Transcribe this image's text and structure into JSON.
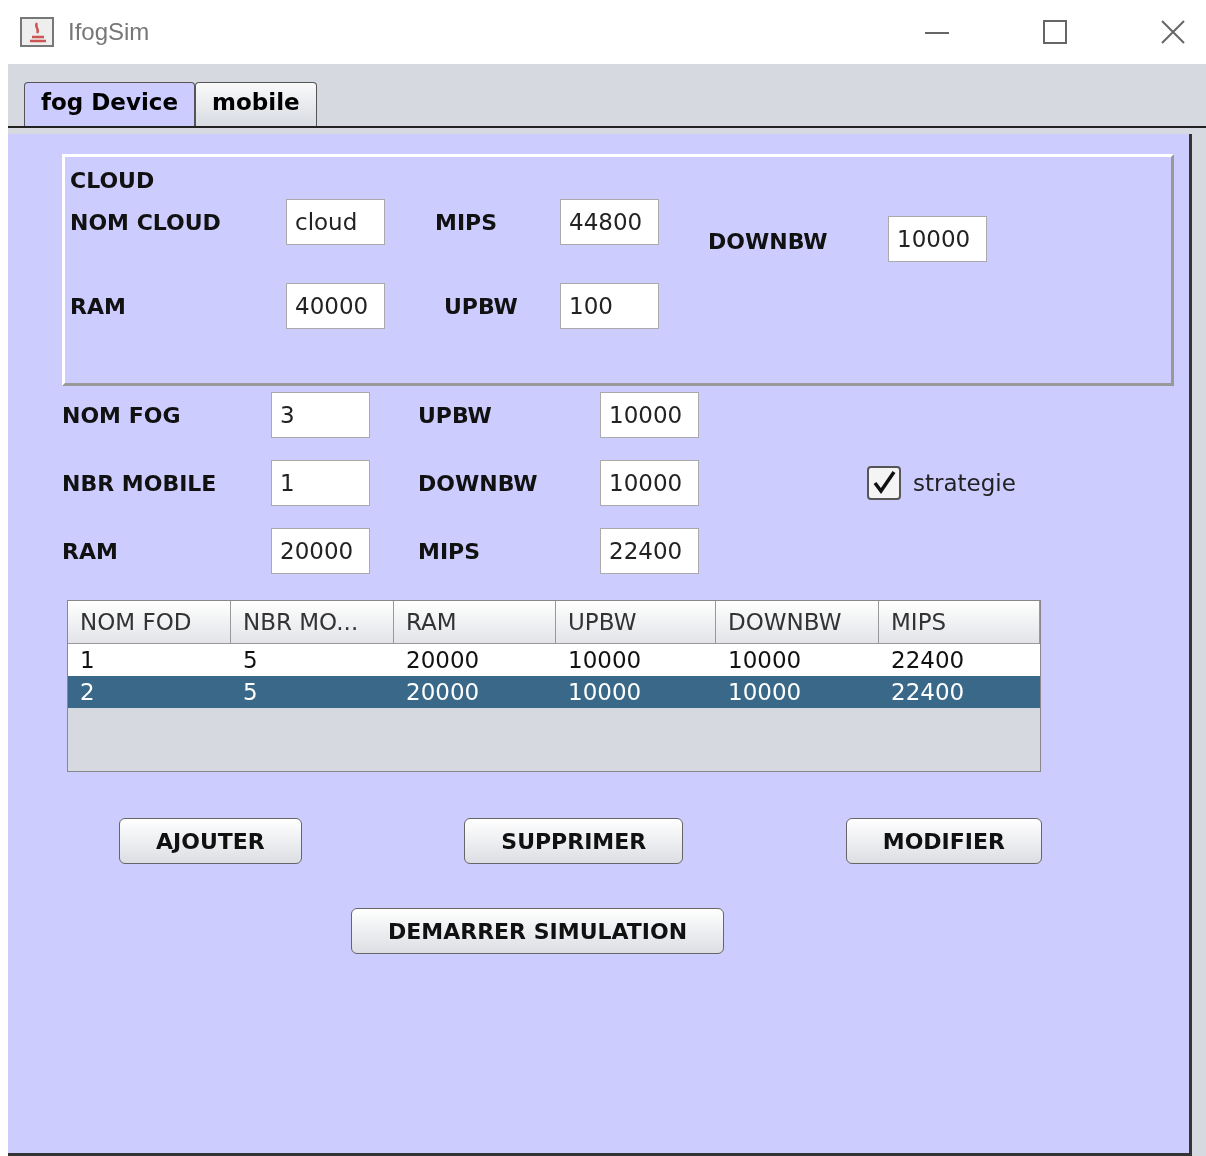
{
  "window": {
    "title": "IfogSim"
  },
  "tabs": [
    {
      "label": "fog Device",
      "selected": true
    },
    {
      "label": "mobile",
      "selected": false
    }
  ],
  "cloud": {
    "title": "CLOUD",
    "nom_cloud": {
      "label": "NOM CLOUD",
      "value": "cloud"
    },
    "mips": {
      "label": "MIPS",
      "value": "44800"
    },
    "downbw": {
      "label": "DOWNBW",
      "value": "10000"
    },
    "ram": {
      "label": "RAM",
      "value": "40000"
    },
    "upbw": {
      "label": "UPBW",
      "value": "100"
    }
  },
  "fog": {
    "rows": [
      {
        "fields": [
          {
            "label": "NOM FOG",
            "value": "3"
          },
          {
            "label": "UPBW",
            "value": "10000"
          }
        ]
      },
      {
        "fields": [
          {
            "label": "NBR MOBILE",
            "value": "1"
          },
          {
            "label": "DOWNBW",
            "value": "10000"
          }
        ]
      },
      {
        "fields": [
          {
            "label": "RAM",
            "value": "20000"
          },
          {
            "label": "MIPS",
            "value": "22400"
          }
        ]
      }
    ],
    "strategy": {
      "label": "strategie",
      "checked": true
    }
  },
  "table": {
    "columns": [
      "NOM FOD",
      "NBR MO...",
      "RAM",
      "UPBW",
      "DOWNBW",
      "MIPS"
    ],
    "rows": [
      {
        "cells": [
          "1",
          "5",
          "20000",
          "10000",
          "10000",
          "22400"
        ],
        "selected": false
      },
      {
        "cells": [
          "2",
          "5",
          "20000",
          "10000",
          "10000",
          "22400"
        ],
        "selected": true
      }
    ]
  },
  "buttons": [
    "AJOUTER",
    "SUPPRIMER",
    "MODIFIER"
  ],
  "start_button": "DEMARRER SIMULATION"
}
